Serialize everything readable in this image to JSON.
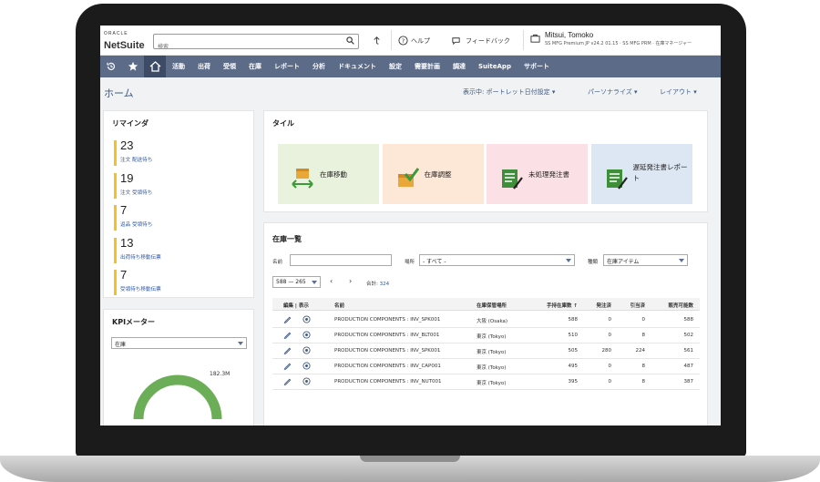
{
  "topbar": {
    "logo_top": "ORACLE",
    "logo_main": "NetSuite",
    "search_placeholder": "検索",
    "help": "ヘルプ",
    "feedback": "フィードバック",
    "user_name": "Mitsui, Tomoko",
    "user_role": "SS MFG Premium JP v24.2 01.15 · SS MFG PRM · 在庫マネージャー"
  },
  "nav": {
    "items": [
      "活動",
      "出荷",
      "受領",
      "在庫",
      "レポート",
      "分析",
      "ドキュメント",
      "設定",
      "需要計画",
      "調達",
      "SuiteApp",
      "サポート"
    ]
  },
  "page": {
    "title": "ホーム",
    "options": [
      "表示中: ポートレット日付設定",
      "パーソナライズ",
      "レイアウト"
    ]
  },
  "reminders": {
    "title": "リマインダ",
    "items": [
      {
        "count": "23",
        "label": "注文 配送待ち"
      },
      {
        "count": "19",
        "label": "注文 受領待ち"
      },
      {
        "count": "7",
        "label": "返品 受領待ち"
      },
      {
        "count": "13",
        "label": "出荷待ち移動伝票"
      },
      {
        "count": "7",
        "label": "受領待ち移動伝票"
      }
    ]
  },
  "kpi": {
    "title": "KPIメーター",
    "select": "在庫",
    "gauge_label": "182.3M"
  },
  "tiles": {
    "title": "タイル",
    "items": [
      {
        "label": "在庫移動",
        "color": "#e8f2dc"
      },
      {
        "label": "在庫調整",
        "color": "#fde7d6"
      },
      {
        "label": "未処理発注書",
        "color": "#fbe1e6"
      },
      {
        "label": "遅延発注書レポート",
        "color": "#dde7f3"
      }
    ]
  },
  "inventory": {
    "title": "在庫一覧",
    "name_label": "名前",
    "location_label": "場所",
    "location_value": "- すべて -",
    "type_label": "種類",
    "type_value": "在庫アイテム",
    "range": "588 — 265",
    "total_label": "合計:",
    "total_value": "324",
    "headers": [
      "編集 | 表示",
      "名前",
      "在庫保管場所",
      "手持在庫数 ↑",
      "発注済",
      "引当済",
      "販売可能数"
    ],
    "rows": [
      {
        "name": "PRODUCTION COMPONENTS : INV_SPK001",
        "location": "大阪 (Osaka)",
        "on_hand": "588",
        "ordered": "0",
        "committed": "0",
        "available": "588"
      },
      {
        "name": "PRODUCTION COMPONENTS : INV_BLT001",
        "location": "東京 (Tokyo)",
        "on_hand": "510",
        "ordered": "0",
        "committed": "8",
        "available": "502"
      },
      {
        "name": "PRODUCTION COMPONENTS : INV_SPK001",
        "location": "東京 (Tokyo)",
        "on_hand": "505",
        "ordered": "280",
        "committed": "224",
        "available": "561"
      },
      {
        "name": "PRODUCTION COMPONENTS : INV_CAP001",
        "location": "東京 (Tokyo)",
        "on_hand": "495",
        "ordered": "0",
        "committed": "8",
        "available": "487"
      },
      {
        "name": "PRODUCTION COMPONENTS : INV_NUT001",
        "location": "東京 (Tokyo)",
        "on_hand": "395",
        "ordered": "0",
        "committed": "8",
        "available": "387"
      }
    ]
  },
  "colors": {
    "nav": "#5c6b88",
    "accent": "#3f5a86",
    "reminder_bar": "#f2c122",
    "gauge": "#6cae58"
  }
}
